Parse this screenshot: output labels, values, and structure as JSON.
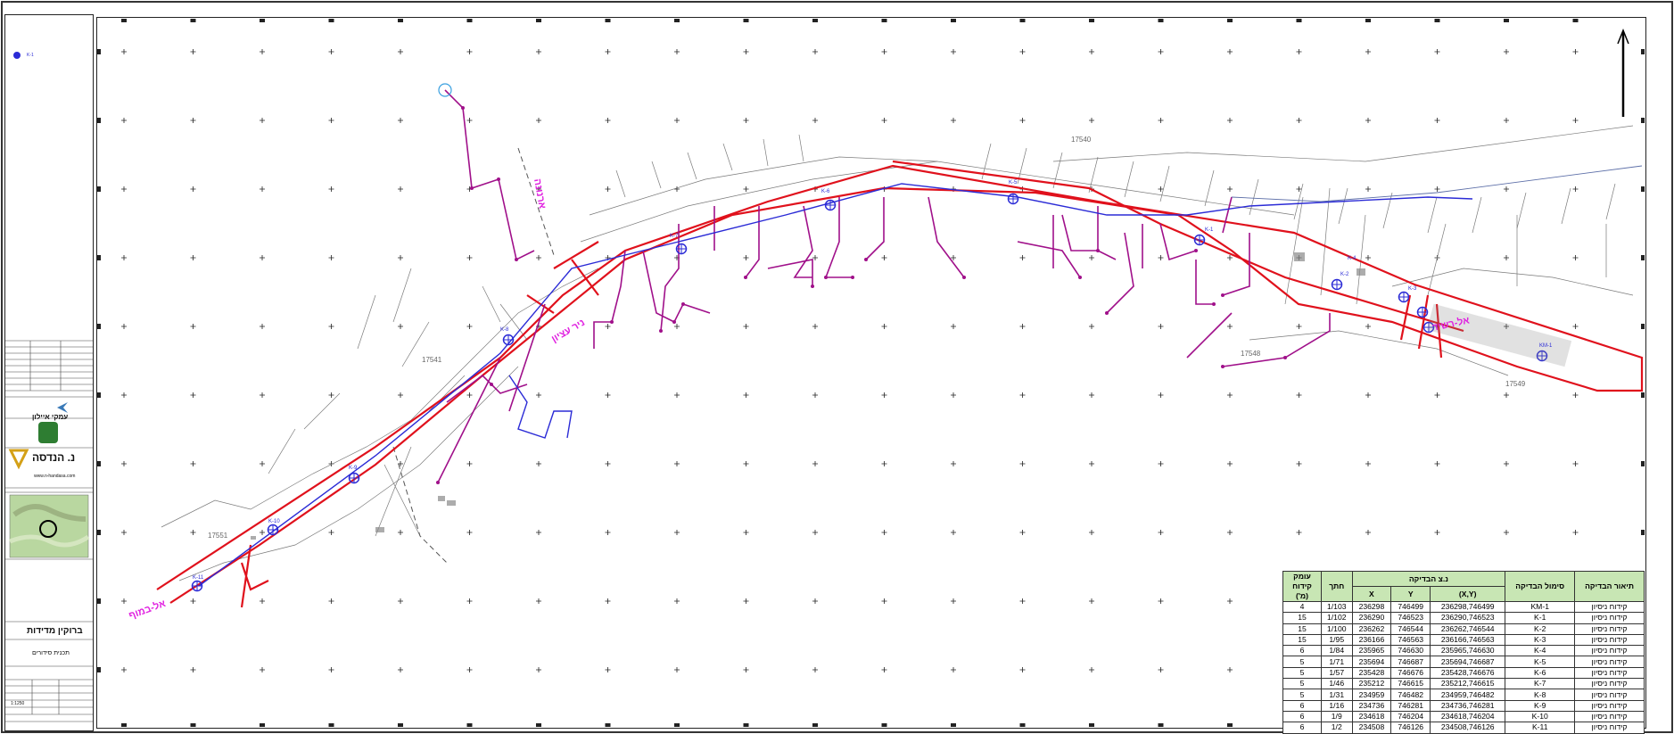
{
  "sidebar": {
    "company_name": "נ. הנדסה",
    "website": "www.n-handasa.com",
    "client": "עמקי איילון",
    "project_title": "ברוקין מדידות",
    "drawing_title": "תכנית סידורים",
    "scale": "1:1250",
    "legend_point_label": "K-1"
  },
  "map": {
    "parcel_labels": [
      "17540",
      "17548",
      "17549",
      "17541",
      "17551"
    ],
    "street_labels": [
      "ארנונה",
      "ניר עציון",
      "אל-רשיד",
      "אל-במוף"
    ],
    "point_labels": [
      "K-1",
      "K-2",
      "K-3",
      "K-4",
      "K-5",
      "K-6",
      "K-7",
      "K-8",
      "K-9",
      "K-10",
      "K-11",
      "KM-1"
    ],
    "colors": {
      "road": "#e0111c",
      "sewer": "#a0108a",
      "water": "#2b2bd6",
      "text": "#e020e0",
      "grid": "#222222"
    }
  },
  "table": {
    "headers": {
      "description": "תיאור הבדיקה",
      "symbol": "סימול הבדיקה",
      "coords": "נ.צ הבדיקה",
      "section": "חתך",
      "depth": "עומק קידוח (מ')",
      "xy": "(X,Y)",
      "y": "Y",
      "x": "X"
    },
    "rows": [
      {
        "description": "קידוח ניסיון",
        "symbol": "KM-1",
        "xy": "236298,746499",
        "y": "746499",
        "x": "236298",
        "section": "1/103",
        "depth": "4"
      },
      {
        "description": "קידוח ניסיון",
        "symbol": "K-1",
        "xy": "236290,746523",
        "y": "746523",
        "x": "236290",
        "section": "1/102",
        "depth": "15"
      },
      {
        "description": "קידוח ניסיון",
        "symbol": "K-2",
        "xy": "236262,746544",
        "y": "746544",
        "x": "236262",
        "section": "1/100",
        "depth": "15"
      },
      {
        "description": "קידוח ניסיון",
        "symbol": "K-3",
        "xy": "236166,746563",
        "y": "746563",
        "x": "236166",
        "section": "1/95",
        "depth": "15"
      },
      {
        "description": "קידוח ניסיון",
        "symbol": "K-4",
        "xy": "235965,746630",
        "y": "746630",
        "x": "235965",
        "section": "1/84",
        "depth": "6"
      },
      {
        "description": "קידוח ניסיון",
        "symbol": "K-5",
        "xy": "235694,746687",
        "y": "746687",
        "x": "235694",
        "section": "1/71",
        "depth": "5"
      },
      {
        "description": "קידוח ניסיון",
        "symbol": "K-6",
        "xy": "235428,746676",
        "y": "746676",
        "x": "235428",
        "section": "1/57",
        "depth": "5"
      },
      {
        "description": "קידוח ניסיון",
        "symbol": "K-7",
        "xy": "235212,746615",
        "y": "746615",
        "x": "235212",
        "section": "1/46",
        "depth": "5"
      },
      {
        "description": "קידוח ניסיון",
        "symbol": "K-8",
        "xy": "234959,746482",
        "y": "746482",
        "x": "234959",
        "section": "1/31",
        "depth": "5"
      },
      {
        "description": "קידוח ניסיון",
        "symbol": "K-9",
        "xy": "234736,746281",
        "y": "746281",
        "x": "234736",
        "section": "1/16",
        "depth": "6"
      },
      {
        "description": "קידוח ניסיון",
        "symbol": "K-10",
        "xy": "234618,746204",
        "y": "746204",
        "x": "234618",
        "section": "1/9",
        "depth": "6"
      },
      {
        "description": "קידוח ניסיון",
        "symbol": "K-11",
        "xy": "234508,746126",
        "y": "746126",
        "x": "234508",
        "section": "1/2",
        "depth": "6"
      }
    ]
  }
}
